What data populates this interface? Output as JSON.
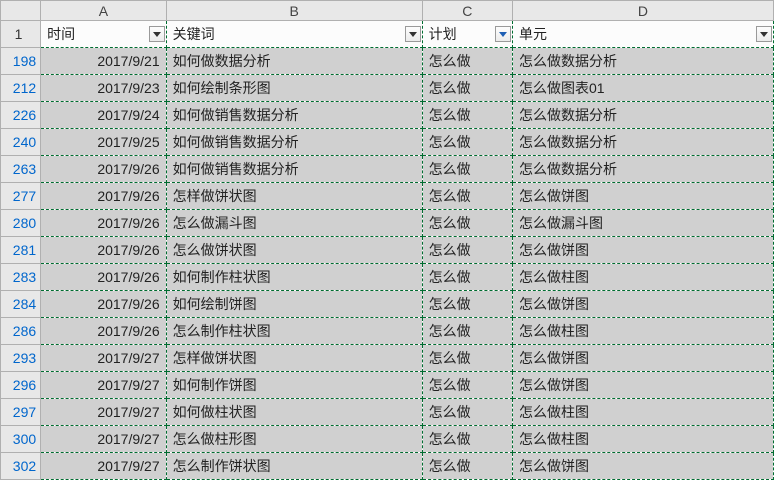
{
  "columns": {
    "rowhdr": "",
    "A": "A",
    "B": "B",
    "C": "C",
    "D": "D"
  },
  "header_row_number": "1",
  "headers": {
    "A": "时间",
    "B": "关键词",
    "C": "计划",
    "D": "单元"
  },
  "filters": {
    "A": {
      "applied": false
    },
    "B": {
      "applied": false
    },
    "C": {
      "applied": true
    },
    "D": {
      "applied": false
    }
  },
  "rows": [
    {
      "n": "198",
      "A": "2017/9/21",
      "B": "如何做数据分析",
      "C": "怎么做",
      "D": "怎么做数据分析"
    },
    {
      "n": "212",
      "A": "2017/9/23",
      "B": "如何绘制条形图",
      "C": "怎么做",
      "D": "怎么做图表01"
    },
    {
      "n": "226",
      "A": "2017/9/24",
      "B": "如何做销售数据分析",
      "C": "怎么做",
      "D": "怎么做数据分析"
    },
    {
      "n": "240",
      "A": "2017/9/25",
      "B": "如何做销售数据分析",
      "C": "怎么做",
      "D": "怎么做数据分析"
    },
    {
      "n": "263",
      "A": "2017/9/26",
      "B": "如何做销售数据分析",
      "C": "怎么做",
      "D": "怎么做数据分析"
    },
    {
      "n": "277",
      "A": "2017/9/26",
      "B": "怎样做饼状图",
      "C": "怎么做",
      "D": "怎么做饼图"
    },
    {
      "n": "280",
      "A": "2017/9/26",
      "B": "怎么做漏斗图",
      "C": "怎么做",
      "D": "怎么做漏斗图"
    },
    {
      "n": "281",
      "A": "2017/9/26",
      "B": "怎么做饼状图",
      "C": "怎么做",
      "D": "怎么做饼图"
    },
    {
      "n": "283",
      "A": "2017/9/26",
      "B": "如何制作柱状图",
      "C": "怎么做",
      "D": "怎么做柱图"
    },
    {
      "n": "284",
      "A": "2017/9/26",
      "B": "如何绘制饼图",
      "C": "怎么做",
      "D": "怎么做饼图"
    },
    {
      "n": "286",
      "A": "2017/9/26",
      "B": "怎么制作柱状图",
      "C": "怎么做",
      "D": "怎么做柱图"
    },
    {
      "n": "293",
      "A": "2017/9/27",
      "B": "怎样做饼状图",
      "C": "怎么做",
      "D": "怎么做饼图"
    },
    {
      "n": "296",
      "A": "2017/9/27",
      "B": "如何制作饼图",
      "C": "怎么做",
      "D": "怎么做饼图"
    },
    {
      "n": "297",
      "A": "2017/9/27",
      "B": "如何做柱状图",
      "C": "怎么做",
      "D": "怎么做柱图"
    },
    {
      "n": "300",
      "A": "2017/9/27",
      "B": "怎么做柱形图",
      "C": "怎么做",
      "D": "怎么做柱图"
    },
    {
      "n": "302",
      "A": "2017/9/27",
      "B": "怎么制作饼状图",
      "C": "怎么做",
      "D": "怎么做饼图"
    }
  ]
}
